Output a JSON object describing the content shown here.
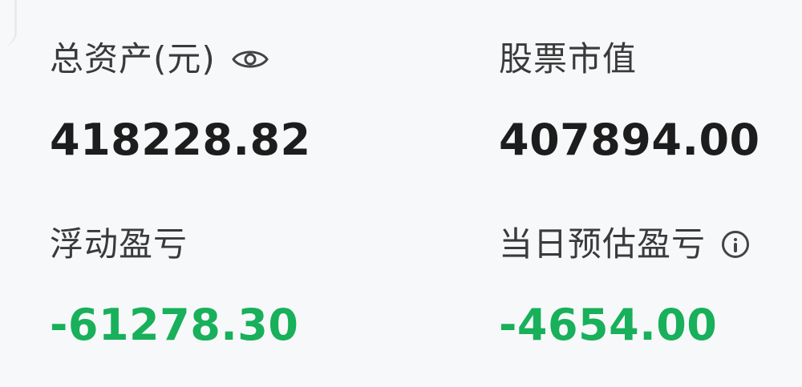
{
  "assets": {
    "total_label": "总资产(元)",
    "total_value": "418228.82",
    "stock_value_label": "股票市值",
    "stock_value": "407894.00",
    "floating_pnl_label": "浮动盈亏",
    "floating_pnl": "-61278.30",
    "today_est_pnl_label": "当日预估盈亏",
    "today_est_pnl": "-4654.00"
  },
  "icons": {
    "eye": "eye-icon",
    "info": "info-icon"
  },
  "colors": {
    "positive_text": "#1d1d1d",
    "negative_text": "#18b05a",
    "label_text": "#3a3a3a"
  }
}
